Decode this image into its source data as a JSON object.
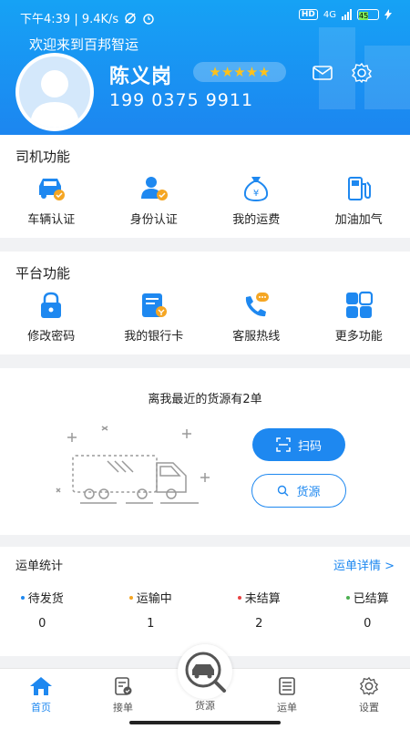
{
  "status_bar": {
    "time_speed": "下午4:39 | 9.4K/s",
    "network": "4G",
    "battery": "45"
  },
  "header": {
    "welcome": "欢迎来到百邦智运",
    "name": "陈义岗",
    "stars": "★★★★★",
    "phone": "199 0375 9911"
  },
  "driver_functions": {
    "title": "司机功能",
    "items": [
      {
        "label": "车辆认证",
        "icon": "truck-icon"
      },
      {
        "label": "身份认证",
        "icon": "person-verify-icon"
      },
      {
        "label": "我的运费",
        "icon": "money-bag-icon"
      },
      {
        "label": "加油加气",
        "icon": "fuel-pump-icon"
      }
    ]
  },
  "platform_functions": {
    "title": "平台功能",
    "items": [
      {
        "label": "修改密码",
        "icon": "lock-icon"
      },
      {
        "label": "我的银行卡",
        "icon": "bank-card-icon"
      },
      {
        "label": "客服热线",
        "icon": "phone-chat-icon"
      },
      {
        "label": "更多功能",
        "icon": "grid-icon"
      }
    ]
  },
  "nearby": {
    "title": "离我最近的货源有2单",
    "scan_label": "扫码",
    "cargo_label": "货源"
  },
  "stats": {
    "title": "运单统计",
    "detail_link": "运单详情 >",
    "items": [
      {
        "label": "待发货",
        "value": "0",
        "dot_color": "#1e88f0"
      },
      {
        "label": "运输中",
        "value": "1",
        "dot_color": "#f5a623"
      },
      {
        "label": "未结算",
        "value": "2",
        "dot_color": "#e94343"
      },
      {
        "label": "已结算",
        "value": "0",
        "dot_color": "#4caf50"
      }
    ]
  },
  "tabbar": {
    "items": [
      {
        "label": "首页",
        "icon": "home-icon"
      },
      {
        "label": "接单",
        "icon": "accept-order-icon"
      },
      {
        "label": "货源",
        "icon": "cargo-search-icon"
      },
      {
        "label": "运单",
        "icon": "waybill-icon"
      },
      {
        "label": "设置",
        "icon": "settings-icon"
      }
    ]
  },
  "colors": {
    "primary": "#1e88f0",
    "header_top": "#16a2f5",
    "star": "#ffc21a"
  }
}
